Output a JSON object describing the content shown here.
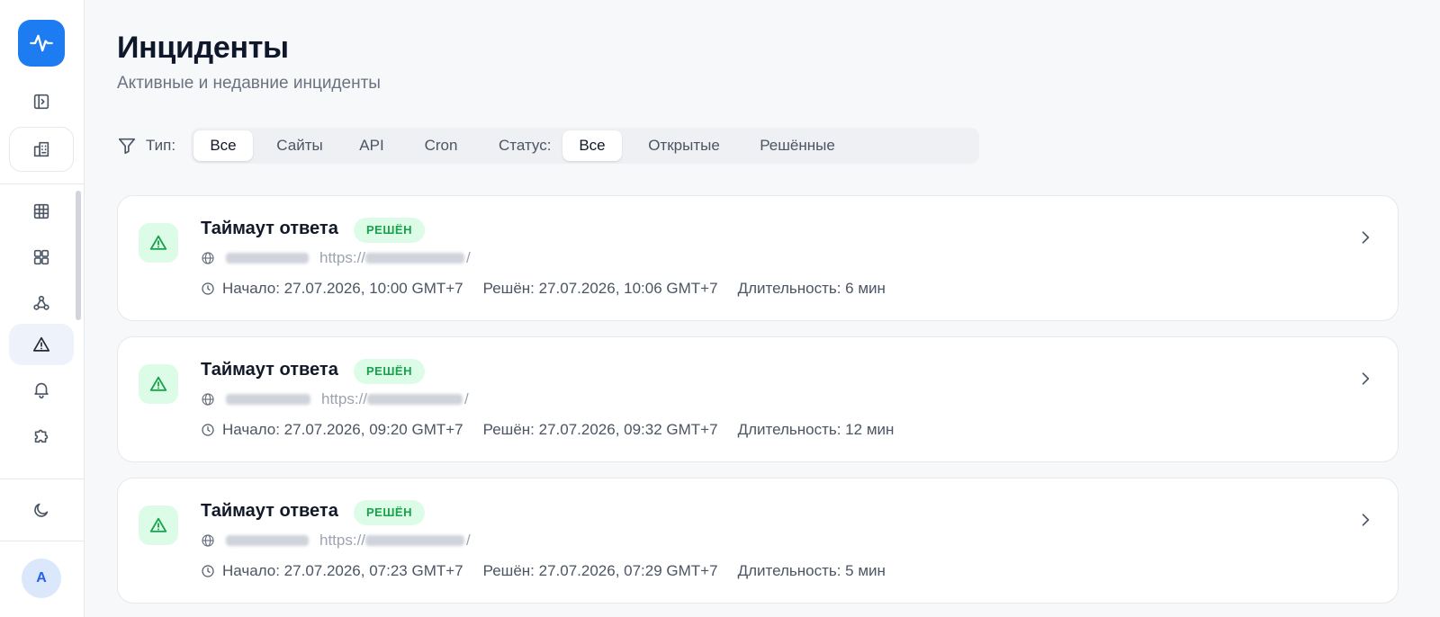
{
  "header": {
    "title": "Инциденты",
    "subtitle": "Активные и недавние инциденты"
  },
  "filters": {
    "type_label": "Тип:",
    "type_options": [
      "Все",
      "Сайты",
      "API",
      "Cron"
    ],
    "type_selected": "Все",
    "status_label": "Статус:",
    "status_options": [
      "Все",
      "Открытые",
      "Решённые"
    ],
    "status_selected": "Все"
  },
  "sidebar": {
    "items": [
      {
        "icon": "panel-toggle-icon"
      },
      {
        "icon": "building-icon"
      },
      {
        "icon": "grid-icon"
      },
      {
        "icon": "dashboard-icon"
      },
      {
        "icon": "webhook-icon"
      },
      {
        "icon": "warning-icon",
        "active": true
      },
      {
        "icon": "bell-icon"
      },
      {
        "icon": "puzzle-icon"
      },
      {
        "icon": "moon-icon"
      }
    ],
    "avatar_initial": "A"
  },
  "incidents": [
    {
      "title": "Таймаут ответа",
      "status": "РЕШЁН",
      "url_prefix": "https://",
      "url_suffix": "/",
      "start": "Начало: 27.07.2026, 10:00 GMT+7",
      "resolved": "Решён: 27.07.2026, 10:06 GMT+7",
      "duration": "Длительность: 6 мин"
    },
    {
      "title": "Таймаут ответа",
      "status": "РЕШЁН",
      "url_prefix": "https://",
      "url_suffix": "/",
      "start": "Начало: 27.07.2026, 09:20 GMT+7",
      "resolved": "Решён: 27.07.2026, 09:32 GMT+7",
      "duration": "Длительность: 12 мин"
    },
    {
      "title": "Таймаут ответа",
      "status": "РЕШЁН",
      "url_prefix": "https://",
      "url_suffix": "/",
      "start": "Начало: 27.07.2026, 07:23 GMT+7",
      "resolved": "Решён: 27.07.2026, 07:29 GMT+7",
      "duration": "Длительность: 5 мин"
    }
  ],
  "colors": {
    "accent": "#1d7cf2",
    "success": "#16a34a",
    "success_bg": "#dcfce7"
  }
}
